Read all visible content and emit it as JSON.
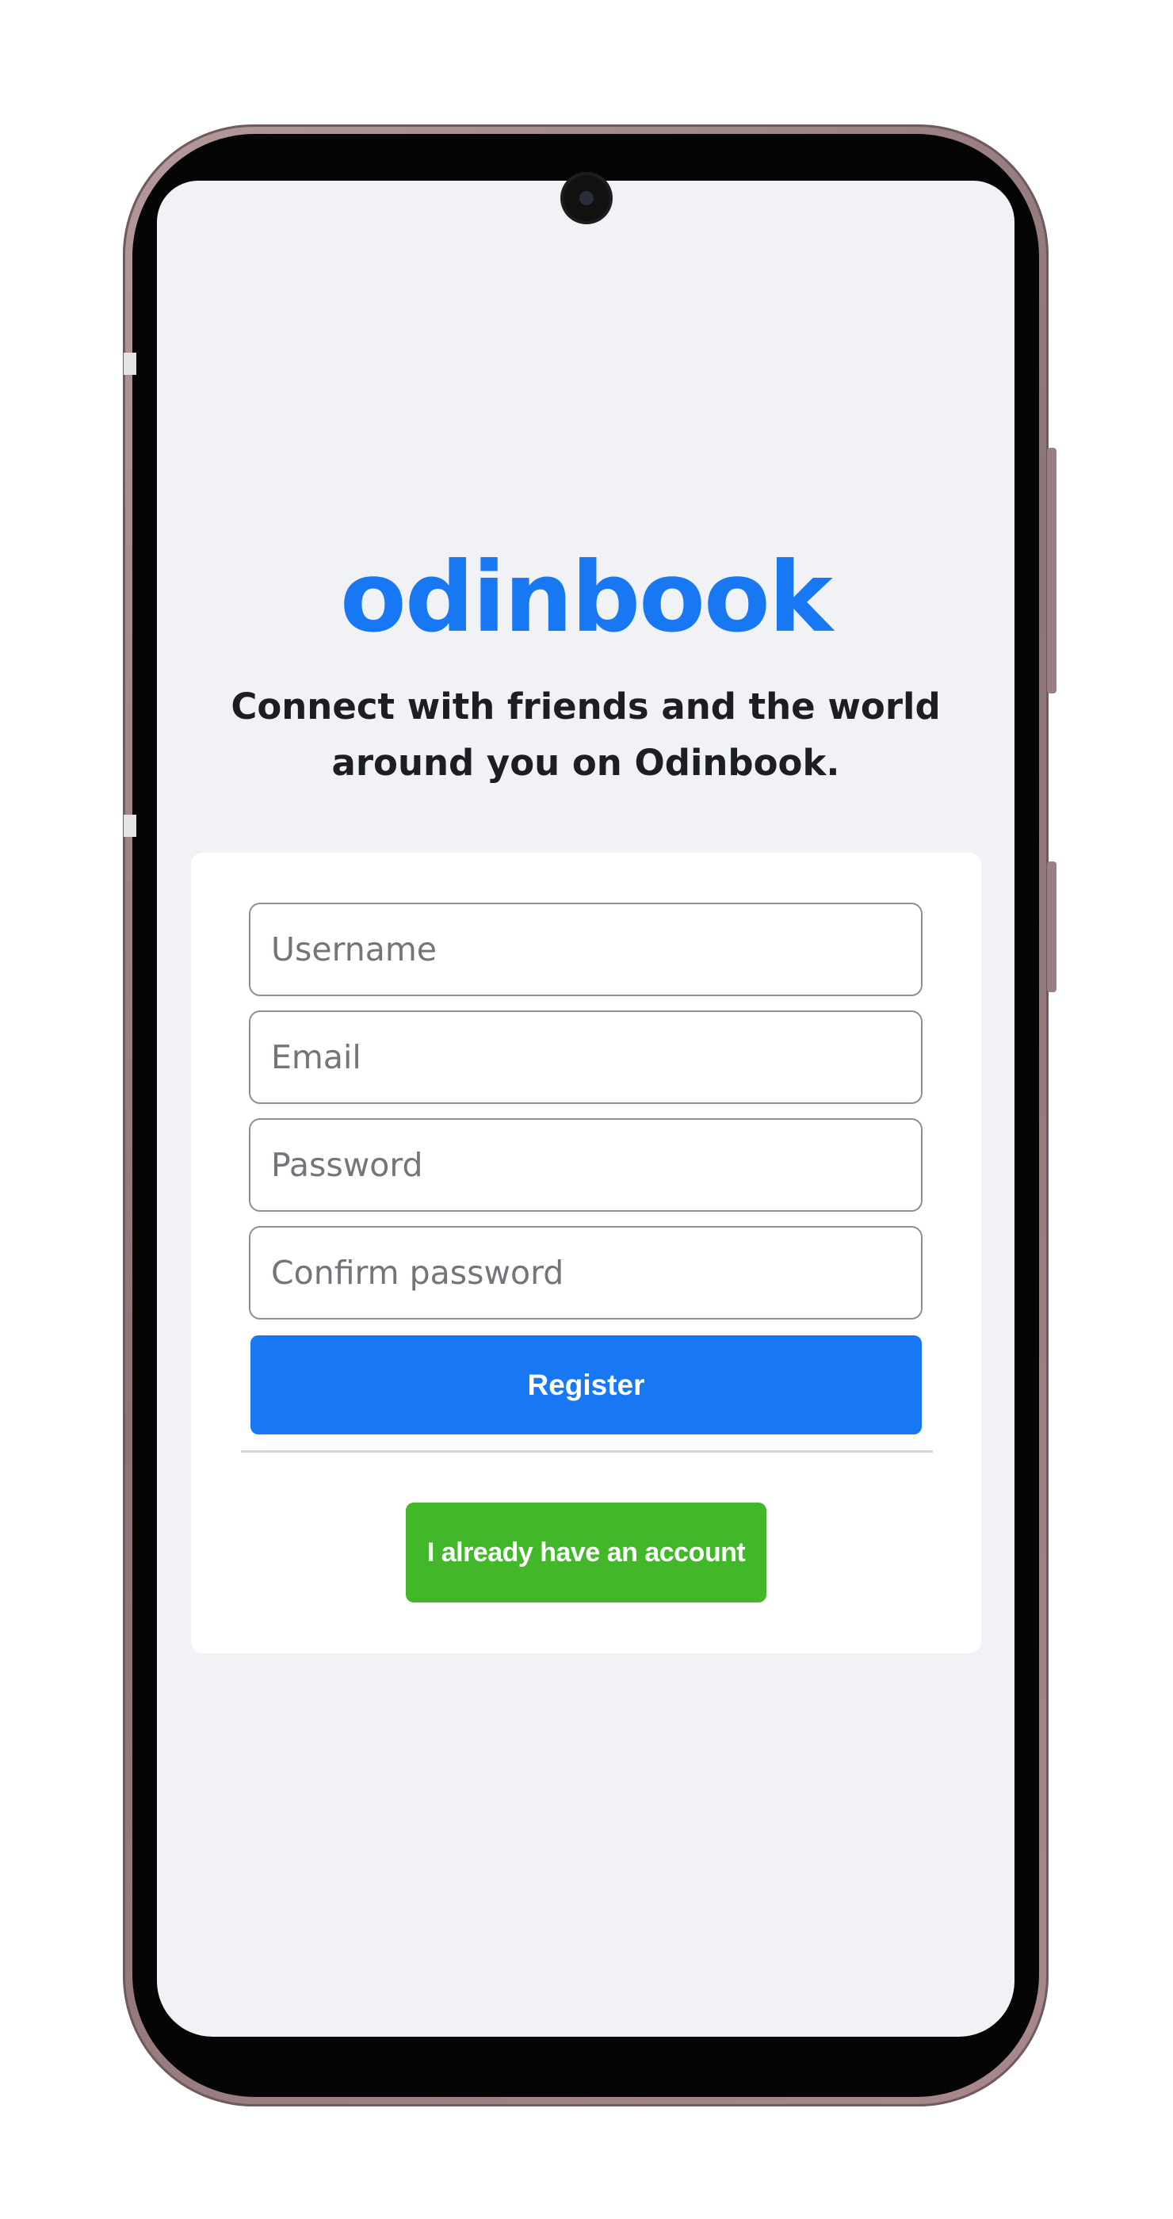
{
  "app": {
    "logo_text": "odinbook",
    "tagline": "Connect with friends and the world around you on Odinbook."
  },
  "register_form": {
    "username_placeholder": "Username",
    "email_placeholder": "Email",
    "password_placeholder": "Password",
    "confirm_password_placeholder": "Confirm password",
    "register_label": "Register",
    "login_label": "I already have an account"
  },
  "colors": {
    "brand_blue": "#1877f2",
    "login_green": "#42b72a",
    "page_background": "#f0f2f5",
    "card_background": "#ffffff"
  }
}
